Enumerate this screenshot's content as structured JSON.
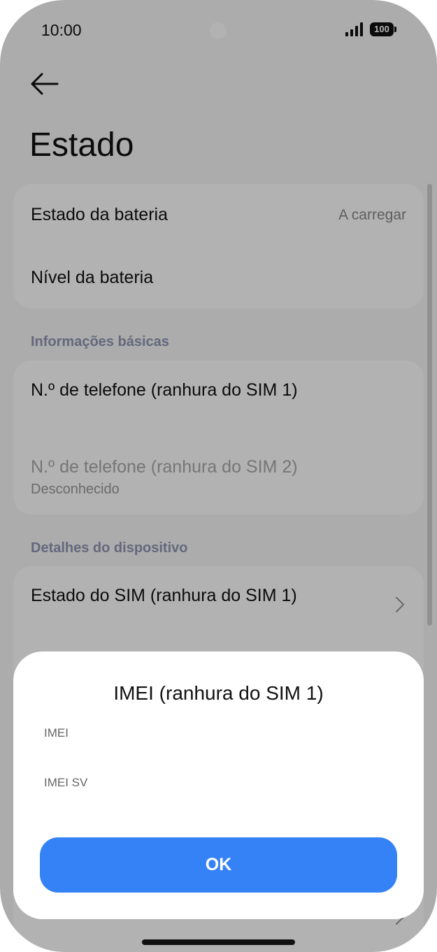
{
  "status_bar": {
    "time": "10:00",
    "battery_level": "100"
  },
  "header": {
    "title": "Estado"
  },
  "battery_card": {
    "rows": [
      {
        "title": "Estado da bateria",
        "value": "A carregar"
      },
      {
        "title": "Nível da bateria"
      }
    ]
  },
  "basic_info": {
    "header": "Informações básicas",
    "rows": [
      {
        "title": "N.º de telefone (ranhura do SIM 1)"
      },
      {
        "title": "N.º de telefone (ranhura do SIM 2)",
        "subtitle": "Desconhecido"
      }
    ]
  },
  "device_details": {
    "header": "Detalhes do dispositivo",
    "rows": [
      {
        "title": "Estado do SIM (ranhura do SIM 1)"
      }
    ]
  },
  "dialog": {
    "title": "IMEI (ranhura do SIM 1)",
    "fields": [
      "IMEI",
      "IMEI SV"
    ],
    "ok_label": "OK"
  },
  "colors": {
    "accent": "#3482f6",
    "section_header": "#8e96b3"
  }
}
